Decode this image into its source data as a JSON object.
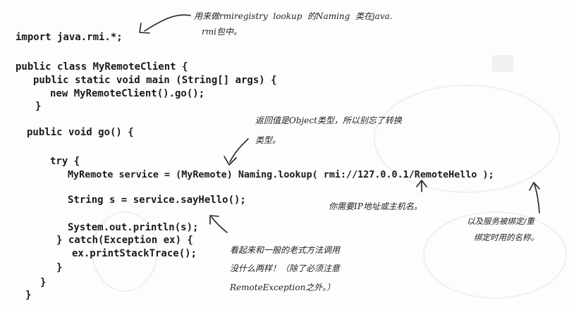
{
  "code": {
    "import": "import java.rmi.*;",
    "class_decl": "public class MyRemoteClient {",
    "main_decl": "public static void main (String[] args) {",
    "main_body": "new MyRemoteClient().go();",
    "main_close": "}",
    "go_decl": "public void go() {",
    "try_open": "try {",
    "lookup_line": "MyRemote service = (MyRemote) Naming.lookup( rmi://127.0.0.1/RemoteHello );",
    "call_line": "String s = service.sayHello();",
    "print_line": "System.out.println(s);",
    "catch_line": "} catch(Exception ex) {",
    "trace_line": "ex.printStackTrace();",
    "catch_close": "}",
    "go_close": "}",
    "class_close": "}"
  },
  "annotations": {
    "naming_line1": "用来做rmiregistry  lookup  的Naming  类在java.",
    "naming_line2": "rmi包中。",
    "cast_line1": "返回值是Object类型，所以别忘了转换",
    "cast_line2": "类型。",
    "host_note": "你需要IP地址或主机名。",
    "name_line1": "以及服务被绑定/重",
    "name_line2": "绑定时用的名称。",
    "call_line1": "看起来和一般的老式方法调用",
    "call_line2": "没什么两样！（除了必须注意",
    "call_line3": "RemoteException之外。）"
  }
}
